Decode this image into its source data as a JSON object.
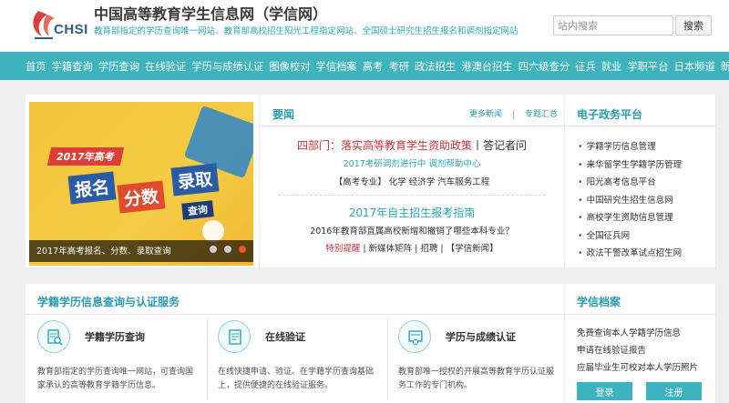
{
  "header": {
    "logo_text": "CHSI",
    "site_title": "中国高等教育学生信息网（学信网）",
    "slogan": "教育部指定的学历查询唯一网站、教育部高校招生阳光工程指定网站、全国硕士研究生招生报名和调剂指定网站",
    "search_placeholder": "站内搜索",
    "search_button": "搜索"
  },
  "nav": [
    "首页",
    "学籍查询",
    "学历查询",
    "在线验证",
    "学历与成绩认证",
    "图像校对",
    "学信档案",
    "高考",
    "考研",
    "政法招生",
    "港澳台招生",
    "四六级查分",
    "征兵",
    "就业",
    "学职平台",
    "日本频道",
    "新职业"
  ],
  "banner": {
    "year_tag": "2017年高考",
    "words": [
      "报名",
      "分数",
      "录取"
    ],
    "sub": "查询",
    "caption": "2017年高考报名、分数、录取查询"
  },
  "news": {
    "title": "要闻",
    "more_news": "更多新闻",
    "topics": "专题汇总",
    "headline1_red": "四部门：落实高等教育学生资助政策",
    "headline1_rest": "丨答记者问",
    "headline2": "2017考研调剂进行中 调剂帮助中心",
    "headline3": "【高考专业】 化学  经济学   汽车服务工程",
    "headline4": "2017年自主招生报考指南",
    "headline5": "2016年教育部直属高校新增和撤销了哪些本科专业？",
    "headline6_red": "特别提醒",
    "headline6_rest": " | 新媒体矩阵 | 招聘 | 【学信新闻】"
  },
  "gov": {
    "title": "电子政务平台",
    "items": [
      "学籍学历信息管理",
      "来华留学生学籍学历管理",
      "阳光高考信息平台",
      "中国研究生招生信息网",
      "高校学生资助信息管理",
      "全国征兵网",
      "政法干警改革试点招生网"
    ]
  },
  "services": {
    "title": "学籍学历信息查询与认证服务",
    "items": [
      {
        "name": "学籍学历查询",
        "desc": "教育部指定的学历查询唯一网站，可查询国家承认的高等教育学籍学历信息。",
        "icon": "search-doc-icon"
      },
      {
        "name": "在线验证",
        "desc": "在线快捷申请、验证。在学籍学历查询基础上，提供便捷的在线验证服务。",
        "icon": "verify-doc-icon"
      },
      {
        "name": "学历与成绩认证",
        "desc": "教育部唯一授权的开展高等教育学历认证服务工作的专门机构。",
        "icon": "certificate-icon"
      }
    ]
  },
  "archive": {
    "title": "学信档案",
    "items": [
      "免费查询本人学籍学历信息",
      "申请在线验证报告",
      "应届毕业生可校对本人学历照片"
    ],
    "login": "登录",
    "register": "注册"
  },
  "colors": {
    "teal": "#3db3bf",
    "accent_red": "#c8333b",
    "banner_yellow": "#f3c33a"
  }
}
